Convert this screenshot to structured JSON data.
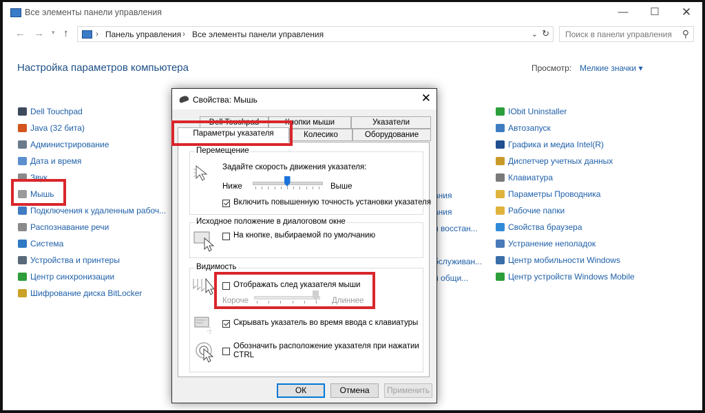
{
  "window": {
    "title": "Все элементы панели управления",
    "controls": {
      "minimize": "—",
      "maximize": "☐",
      "close": "✕"
    }
  },
  "nav": {
    "back": "←",
    "forward": "→",
    "up": "↑",
    "crumbs": [
      "Панель управления",
      "Все элементы панели управления"
    ],
    "search_placeholder": "Поиск в панели управления"
  },
  "header": {
    "title": "Настройка параметров компьютера",
    "view_label": "Просмотр:",
    "view_value": "Мелкие значки ▾"
  },
  "left_items": [
    {
      "label": "Dell Touchpad",
      "icon": "touchpad-icon",
      "color": "#3c4a5c"
    },
    {
      "label": "Java (32 бита)",
      "icon": "java-icon",
      "color": "#d3541f"
    },
    {
      "label": "Администрирование",
      "icon": "admin-tools-icon",
      "color": "#6b7b8c"
    },
    {
      "label": "Дата и время",
      "icon": "clock-icon",
      "color": "#5b8fd0"
    },
    {
      "label": "Звук",
      "icon": "speaker-icon",
      "color": "#8a8a8a"
    },
    {
      "label": "Мышь",
      "icon": "mouse-icon",
      "color": "#9a9a9a"
    },
    {
      "label": "Подключения к удаленным рабоч...",
      "icon": "remote-icon",
      "color": "#3f7cc2"
    },
    {
      "label": "Распознавание речи",
      "icon": "microphone-icon",
      "color": "#8a8a8a"
    },
    {
      "label": "Система",
      "icon": "computer-icon",
      "color": "#2f78c4"
    },
    {
      "label": "Устройства и принтеры",
      "icon": "printer-icon",
      "color": "#5a6a7a"
    },
    {
      "label": "Центр синхронизации",
      "icon": "sync-icon",
      "color": "#2e9e3a"
    },
    {
      "label": "Шифрование диска BitLocker",
      "icon": "bitlocker-icon",
      "color": "#c9a227"
    }
  ],
  "middle_fragments": [
    "ания",
    "ания",
    "и восстан...",
    "бслуживан...",
    "и общи..."
  ],
  "right_items": [
    {
      "label": "IObit Uninstaller",
      "icon": "iobit-icon",
      "color": "#2c9e3a"
    },
    {
      "label": "Автозапуск",
      "icon": "autoplay-icon",
      "color": "#3f7cc2"
    },
    {
      "label": "Графика и медиа Intel(R)",
      "icon": "intel-graphics-icon",
      "color": "#1f4f8f"
    },
    {
      "label": "Диспетчер учетных данных",
      "icon": "credentials-icon",
      "color": "#c99a2a"
    },
    {
      "label": "Клавиатура",
      "icon": "keyboard-icon",
      "color": "#7a7a7a"
    },
    {
      "label": "Параметры Проводника",
      "icon": "folder-options-icon",
      "color": "#e0b33d"
    },
    {
      "label": "Рабочие папки",
      "icon": "work-folders-icon",
      "color": "#e0b33d"
    },
    {
      "label": "Свойства браузера",
      "icon": "internet-options-icon",
      "color": "#2f8ad8"
    },
    {
      "label": "Устранение неполадок",
      "icon": "troubleshoot-icon",
      "color": "#4a7ab8"
    },
    {
      "label": "Центр мобильности Windows",
      "icon": "mobility-icon",
      "color": "#3a6ea8"
    },
    {
      "label": "Центр устройств Windows Mobile",
      "icon": "windows-mobile-icon",
      "color": "#2c9e3a"
    }
  ],
  "dialog": {
    "title": "Свойства: Мышь",
    "close": "✕",
    "tabs_back": [
      "Dell Touchpad",
      "Кнопки мыши",
      "Указатели"
    ],
    "tabs_front": [
      "Параметры указателя",
      "Колесико",
      "Оборудование"
    ],
    "motion": {
      "group": "Перемещение",
      "prompt": "Задайте скорость движения указателя:",
      "slow": "Ниже",
      "fast": "Выше",
      "speed_fraction": 0.5,
      "precision_label": "Включить повышенную точность установки указателя",
      "precision_checked": true
    },
    "snap": {
      "group": "Исходное положение в диалоговом окне",
      "label": "На кнопке, выбираемой по умолчанию",
      "checked": false
    },
    "visibility": {
      "group": "Видимость",
      "trails_label": "Отображать след указателя мыши",
      "trails_checked": false,
      "short": "Короче",
      "long": "Длиннее",
      "trail_fraction": 1.0,
      "hide_label": "Скрывать указатель во время ввода с клавиатуры",
      "hide_checked": true,
      "ctrl_label_line1": "Обозначить расположение указателя при нажатии",
      "ctrl_label_line2": "CTRL",
      "ctrl_checked": false
    },
    "buttons": {
      "ok": "ОК",
      "cancel": "Отмена",
      "apply": "Применить"
    }
  }
}
